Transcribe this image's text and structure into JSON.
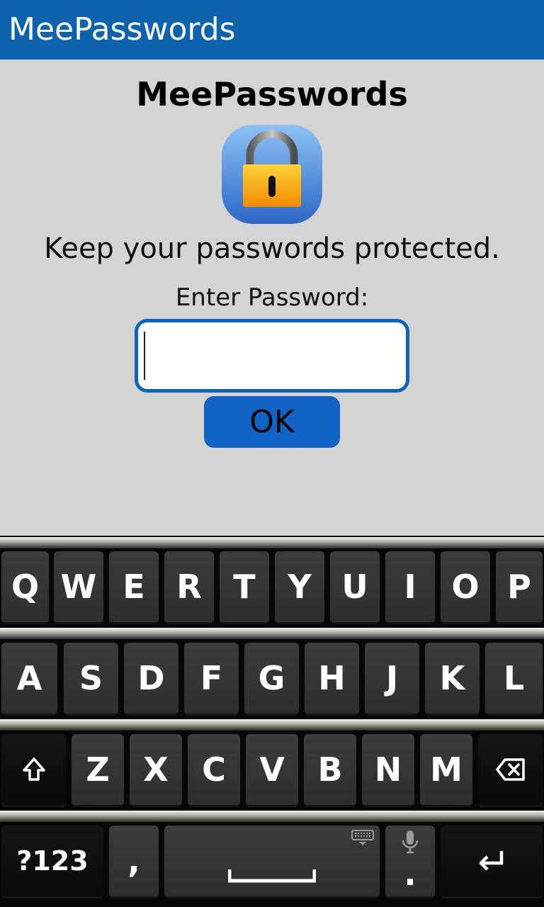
{
  "titlebar": {
    "title": "MeePasswords"
  },
  "main": {
    "heading": "MeePasswords",
    "tagline": "Keep your passwords protected.",
    "password_label": "Enter Password:",
    "password_value": "",
    "password_placeholder": "",
    "ok_label": "OK",
    "icon": "lock-icon"
  },
  "keyboard": {
    "row1": [
      "Q",
      "W",
      "E",
      "R",
      "T",
      "Y",
      "U",
      "I",
      "O",
      "P"
    ],
    "row2": [
      "A",
      "S",
      "D",
      "F",
      "G",
      "H",
      "J",
      "K",
      "L"
    ],
    "row3": [
      "Z",
      "X",
      "C",
      "V",
      "B",
      "N",
      "M"
    ],
    "symbols_label": "?123",
    "comma_label": ",",
    "period_label": ".",
    "icons": [
      "shift-icon",
      "backspace-icon",
      "space-icon",
      "keyboard-icon",
      "microphone-icon",
      "enter-icon"
    ]
  },
  "colors": {
    "titlebar": "#0d64ad",
    "accent": "#1065c4",
    "background": "#d4d4d4"
  }
}
